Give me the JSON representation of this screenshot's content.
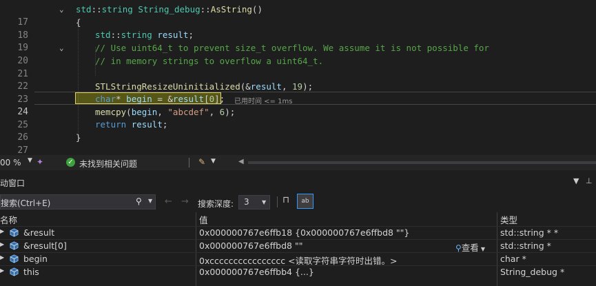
{
  "editor": {
    "lines": [
      {
        "num": "17"
      },
      {
        "num": "18"
      },
      {
        "num": "19"
      },
      {
        "num": "20"
      },
      {
        "num": "21"
      },
      {
        "num": "22"
      },
      {
        "num": "23"
      },
      {
        "num": "24"
      },
      {
        "num": "25"
      },
      {
        "num": "26"
      },
      {
        "num": "27"
      }
    ],
    "code": {
      "l17_ns": "std",
      "l17_sep": "::",
      "l17_type": "string",
      "l17_cls": "String_debug",
      "l17_sep2": "::",
      "l17_fn": "AsString",
      "l17_paren": "()",
      "l18": "{",
      "l19_ns": "std",
      "l19_sep": "::",
      "l19_type": "string",
      "l19_var": "result",
      "l19_end": ";",
      "l20": "// Use uint64_t to prevent size_t overflow. We assume it is not possible for",
      "l21": "// in memory strings to overflow a uint64_t.",
      "l23_fn": "STLStringResizeUninitialized",
      "l23_a": "(&",
      "l23_var": "result",
      "l23_b": ", ",
      "l23_num": "19",
      "l23_c": ");",
      "l24_kw": "char",
      "l24_a": "* ",
      "l24_var": "begin",
      "l24_b": " = &",
      "l24_var2": "result",
      "l24_c": "[",
      "l24_num": "0",
      "l24_d": "];",
      "l25_fn": "memcpy",
      "l25_a": "(",
      "l25_var": "begin",
      "l25_b": ", ",
      "l25_str": "\"abcdef\"",
      "l25_c": ", ",
      "l25_num": "6",
      "l25_d": ");",
      "l26_kw": "return",
      "l26_var": "result",
      "l26_end": ";",
      "l27": "}"
    },
    "exec_hint": "已用时间 <= 1ms"
  },
  "status_strip": {
    "zoom": "00 %",
    "issues": "未找到相关问题"
  },
  "panel": {
    "title": "动窗口",
    "search_placeholder": "搜索(Ctrl+E)",
    "depth_label": "搜索深度:",
    "depth_value": "3",
    "hex_label": "ab",
    "columns": {
      "name": "名称",
      "value": "值",
      "type": "类型"
    },
    "viewer_label": "查看",
    "rows": [
      {
        "name": "&result",
        "value": "0x000000767e6ffb18 {0x000000767e6ffbd8 \"\"}",
        "type": "std::string * *"
      },
      {
        "name": "&result[0]",
        "value": "0x000000767e6ffbd8 \"\"",
        "type": "std::string *"
      },
      {
        "name": "begin",
        "value": "0xcccccccccccccccc <读取字符串字符时出错。>",
        "type": "char *"
      },
      {
        "name": "this",
        "value": "0x000000767e6ffbb4 {...}",
        "type": "String_debug *"
      }
    ]
  },
  "colors": {
    "accent": "#3399ff",
    "highlight": "#e2d26a",
    "ok": "#3fa03f"
  }
}
